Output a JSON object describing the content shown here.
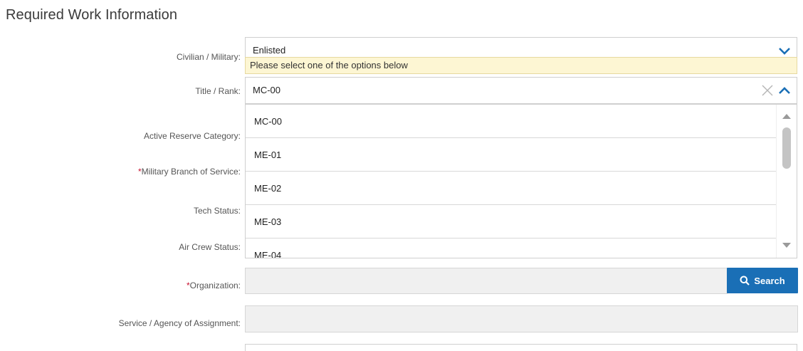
{
  "section": {
    "title": "Required Work Information"
  },
  "labels": {
    "civilian_military": "Civilian / Military:",
    "title_rank": "Title / Rank:",
    "active_reserve": "Active Reserve Category:",
    "military_branch": "Military Branch of Service:",
    "tech_status": "Tech Status:",
    "air_crew_status": "Air Crew Status:",
    "organization": "Organization:",
    "service_agency": "Service / Agency of Assignment:",
    "required_mark": "*"
  },
  "civilian_military": {
    "value": "Enlisted"
  },
  "tooltip": {
    "text": "Please select one of the options below"
  },
  "title_rank": {
    "value": "MC-00",
    "options": [
      "MC-00",
      "ME-01",
      "ME-02",
      "ME-03",
      "ME-04"
    ]
  },
  "organization": {
    "search_label": "Search"
  },
  "colors": {
    "accent": "#1a6fb6",
    "tooltip_bg": "#fdf6d3",
    "required": "#c8102e"
  }
}
